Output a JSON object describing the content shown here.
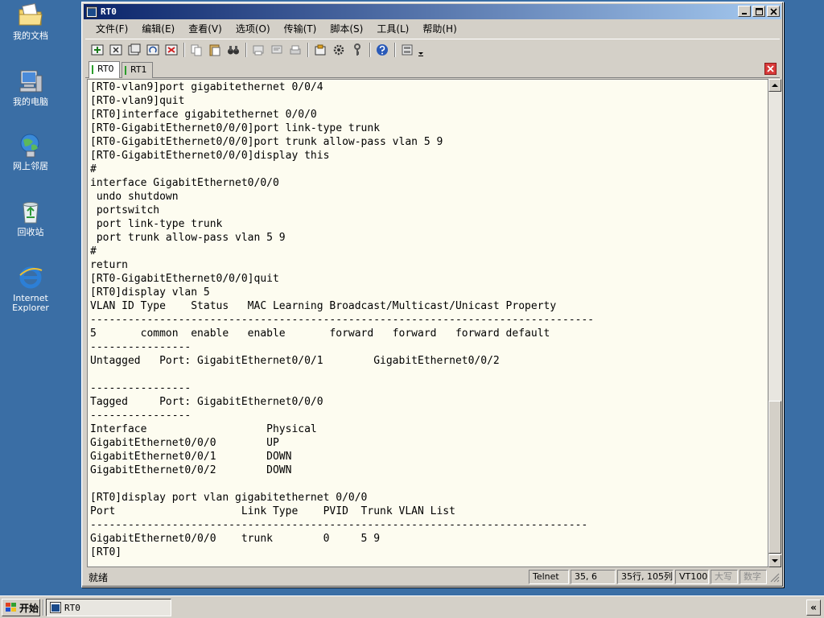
{
  "desktop": {
    "icons": [
      {
        "label": "我的文档",
        "icon": "documents-folder-icon"
      },
      {
        "label": "我的电脑",
        "icon": "computer-icon"
      },
      {
        "label": "网上邻居",
        "icon": "network-icon"
      },
      {
        "label": "回收站",
        "icon": "recycle-bin-icon"
      },
      {
        "label": "Internet\nExplorer",
        "icon": "internet-explorer-icon"
      }
    ]
  },
  "window": {
    "title": "RT0",
    "menu": [
      "文件(F)",
      "编辑(E)",
      "查看(V)",
      "选项(O)",
      "传输(T)",
      "脚本(S)",
      "工具(L)",
      "帮助(H)"
    ],
    "tabs": [
      {
        "label": "RT0",
        "active": true
      },
      {
        "label": "RT1",
        "active": false
      }
    ],
    "terminal_lines": [
      "[RT0-vlan9]port gigabitethernet 0/0/4",
      "[RT0-vlan9]quit",
      "[RT0]interface gigabitethernet 0/0/0",
      "[RT0-GigabitEthernet0/0/0]port link-type trunk",
      "[RT0-GigabitEthernet0/0/0]port trunk allow-pass vlan 5 9",
      "[RT0-GigabitEthernet0/0/0]display this",
      "#",
      "interface GigabitEthernet0/0/0",
      " undo shutdown",
      " portswitch",
      " port link-type trunk",
      " port trunk allow-pass vlan 5 9",
      "#",
      "return",
      "[RT0-GigabitEthernet0/0/0]quit",
      "[RT0]display vlan 5",
      "VLAN ID Type    Status   MAC Learning Broadcast/Multicast/Unicast Property",
      "--------------------------------------------------------------------------------",
      "5       common  enable   enable       forward   forward   forward default",
      "----------------",
      "Untagged   Port: GigabitEthernet0/0/1        GigabitEthernet0/0/2",
      "",
      "----------------",
      "Tagged     Port: GigabitEthernet0/0/0",
      "----------------",
      "Interface                   Physical",
      "GigabitEthernet0/0/0        UP",
      "GigabitEthernet0/0/1        DOWN",
      "GigabitEthernet0/0/2        DOWN",
      "",
      "[RT0]display port vlan gigabitethernet 0/0/0",
      "Port                    Link Type    PVID  Trunk VLAN List",
      "-------------------------------------------------------------------------------",
      "GigabitEthernet0/0/0    trunk        0     5 9",
      "[RT0]"
    ],
    "status": {
      "main": "就绪",
      "protocol": "Telnet",
      "cursor": "35,   6",
      "size": "35行, 105列",
      "terminal_type": "VT100",
      "caps": "大写",
      "num": "数字"
    }
  },
  "taskbar": {
    "start_label": "开始",
    "task_label": "RT0",
    "tray_label": "«"
  }
}
